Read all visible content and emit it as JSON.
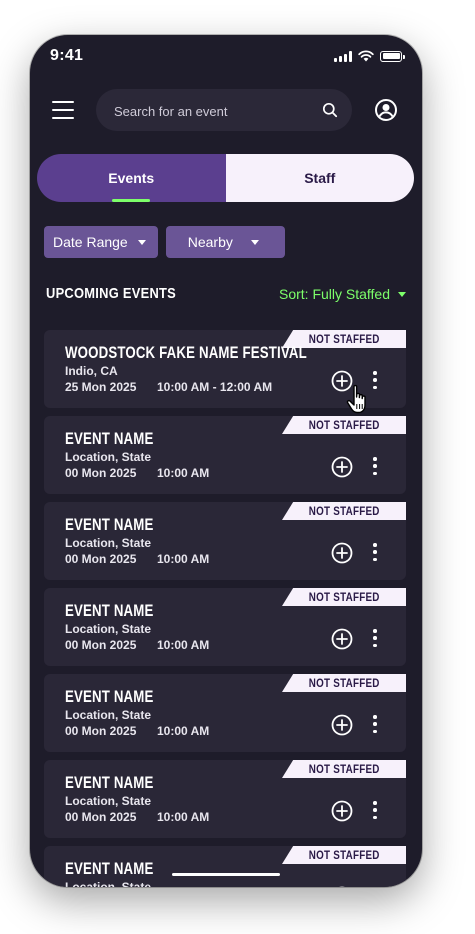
{
  "status_bar": {
    "time": "9:41"
  },
  "search": {
    "placeholder": "Search for an event"
  },
  "tabs": {
    "events": "Events",
    "staff": "Staff",
    "active": "events"
  },
  "filters": {
    "date_range": "Date Range",
    "nearby": "Nearby"
  },
  "section": {
    "title": "UPCOMING EVENTS",
    "sort_label": "Sort: Fully Staffed"
  },
  "colors": {
    "background": "#1e1c2a",
    "card": "#2a2737",
    "accent_purple": "#5b3f8f",
    "filter_purple": "#6a5596",
    "accent_green": "#7dff6a",
    "badge_bg": "#f7f1fb"
  },
  "events": [
    {
      "title": "WOODSTOCK FAKE NAME FESTIVAL",
      "location": "Indio, CA",
      "date": "25 Mon 2025",
      "time": "10:00 AM - 12:00 AM",
      "badge": "NOT STAFFED"
    },
    {
      "title": "EVENT NAME",
      "location": "Location, State",
      "date": "00 Mon 2025",
      "time": "10:00 AM",
      "badge": "NOT STAFFED"
    },
    {
      "title": "EVENT NAME",
      "location": "Location, State",
      "date": "00 Mon 2025",
      "time": "10:00 AM",
      "badge": "NOT STAFFED"
    },
    {
      "title": "EVENT NAME",
      "location": "Location, State",
      "date": "00 Mon 2025",
      "time": "10:00 AM",
      "badge": "NOT STAFFED"
    },
    {
      "title": "EVENT NAME",
      "location": "Location, State",
      "date": "00 Mon 2025",
      "time": "10:00 AM",
      "badge": "NOT STAFFED"
    },
    {
      "title": "EVENT NAME",
      "location": "Location, State",
      "date": "00 Mon 2025",
      "time": "10:00 AM",
      "badge": "NOT STAFFED"
    },
    {
      "title": "EVENT NAME",
      "location": "Location, State",
      "date": "",
      "time": "",
      "badge": "NOT STAFFED"
    }
  ],
  "icons": {
    "menu": "hamburger-menu-icon",
    "search": "search-icon",
    "profile": "user-circle-icon",
    "add": "plus-circle-icon",
    "more": "vertical-dots-icon",
    "cursor": "hand-pointer-icon"
  }
}
